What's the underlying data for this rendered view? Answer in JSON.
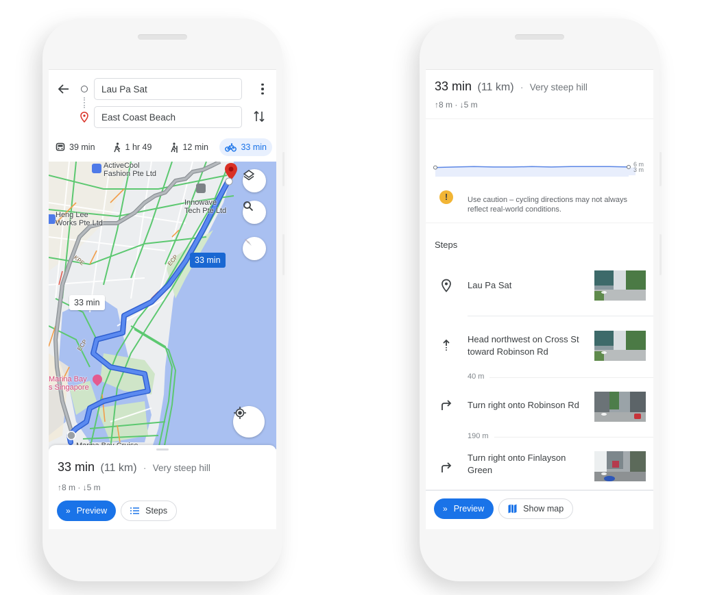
{
  "left_phone": {
    "origin": "Lau Pa Sat",
    "destination": "East Coast Beach",
    "travel_modes": [
      {
        "icon": "transit-icon",
        "glyph": "🚆",
        "label": "39 min",
        "active": false
      },
      {
        "icon": "walk-icon",
        "glyph": "🚶",
        "label": "1 hr 49",
        "active": false
      },
      {
        "icon": "hike-icon",
        "glyph": "🥾",
        "label": "12 min",
        "active": false
      },
      {
        "icon": "bicycle-icon",
        "glyph": "🚲",
        "label": "33 min",
        "active": true
      }
    ],
    "map": {
      "labels": {
        "poi1_line1": "ActiveCool",
        "poi1_line2": "Fashion Pte Ltd",
        "poi2_line1": "Heng Lee",
        "poi2_line2": "Works Pte Ltd",
        "poi3_line1": "Innowave",
        "poi3_line2": "Tech Pte Ltd",
        "poi4_line1": "Marina Bay",
        "poi4_line2": "s Singapore",
        "poi5": "Marina Bay Cruise",
        "road_kpe": "KPE",
        "road_ecp1": "ECP",
        "road_ecp2": "ECP"
      },
      "route_primary_label": "33 min",
      "route_alt_label": "33 min",
      "colors": {
        "route": "#4a7be8",
        "route_border": "#2f5fd0",
        "alt_route": "#9aa0a6",
        "water": "#a7bff0",
        "park": "#cde5c3",
        "traffic_green": "#5cc870",
        "pin": "#d93025"
      }
    },
    "summary": {
      "duration": "33 min",
      "distance": "(11 km)",
      "separator": "·",
      "terrain": "Very steep hill",
      "elevation": "↑8 m · ↓5 m"
    },
    "buttons": {
      "preview": "Preview",
      "steps": "Steps"
    }
  },
  "right_phone": {
    "summary": {
      "duration": "33 min",
      "distance": "(11 km)",
      "separator": "·",
      "terrain": "Very steep hill",
      "elevation": "↑8 m · ↓5 m"
    },
    "elevation_chart": {
      "y_max_label": "6 m",
      "y_min_label": "3 m"
    },
    "caution": "Use caution – cycling directions may not always reflect real-world conditions.",
    "steps_title": "Steps",
    "steps": [
      {
        "icon": "place-icon",
        "glyph": "⊙",
        "text": "Lau Pa Sat",
        "distance_after": ""
      },
      {
        "icon": "straight-arrow-icon",
        "glyph": "↑",
        "text": "Head northwest on Cross St toward Robinson Rd",
        "distance_after": "40 m"
      },
      {
        "icon": "turn-right-icon",
        "glyph": "↱",
        "text": "Turn right onto Robinson Rd",
        "distance_after": "190 m"
      },
      {
        "icon": "turn-right-icon",
        "glyph": "↱",
        "text": "Turn right onto Finlayson Green",
        "distance_after": ""
      }
    ],
    "buttons": {
      "preview": "Preview",
      "show_map": "Show map"
    }
  },
  "chart_data": {
    "type": "area",
    "title": "",
    "xlabel": "",
    "ylabel": "",
    "x": [
      0,
      0.1,
      0.2,
      0.3,
      0.4,
      0.5,
      0.6,
      0.7,
      0.8,
      0.9,
      1.0
    ],
    "values": [
      4,
      4.1,
      4.2,
      4.1,
      4.1,
      4.2,
      4.1,
      4.2,
      4.2,
      4.2,
      4.1
    ],
    "ylim": [
      3,
      6
    ],
    "y_tick_labels": [
      "6 m",
      "3 m"
    ],
    "grid": false
  }
}
